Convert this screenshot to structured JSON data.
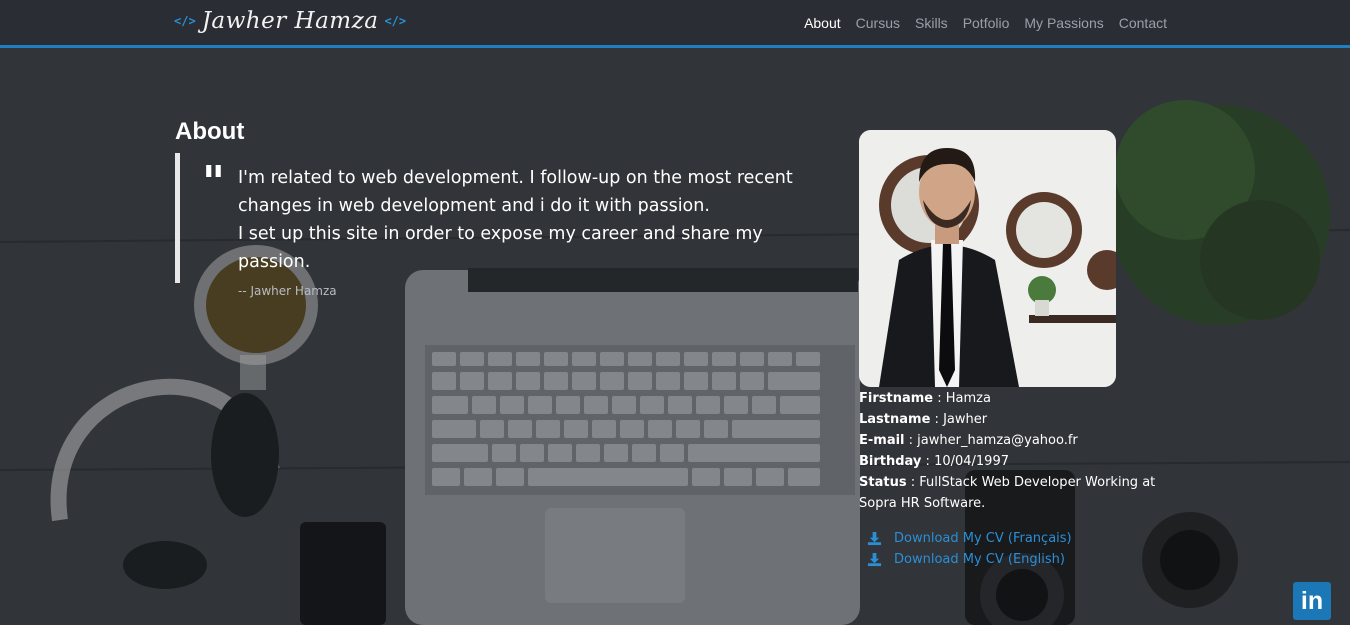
{
  "brand": {
    "code_left": "</>",
    "name": "Jawher Hamza",
    "code_right": "</>"
  },
  "nav": {
    "items": [
      {
        "label": "About",
        "active": true
      },
      {
        "label": "Cursus",
        "active": false
      },
      {
        "label": "Skills",
        "active": false
      },
      {
        "label": "Potfolio",
        "active": false
      },
      {
        "label": "My Passions",
        "active": false
      },
      {
        "label": "Contact",
        "active": false
      }
    ]
  },
  "about": {
    "title": "About",
    "quote_mark": "\"",
    "quote_lines": [
      "I'm related to web development. I follow-up on the most recent",
      "changes in web development and i do it with passion.",
      "I set up this site in order to expose my career and share my passion."
    ],
    "author": "--  Jawher Hamza"
  },
  "profile": {
    "fields": [
      {
        "label": "Firstname",
        "sep": " : ",
        "value": "Hamza"
      },
      {
        "label": "Lastname",
        "sep": " : ",
        "value": "Jawher"
      },
      {
        "label": "E-mail",
        "sep": " : ",
        "value": "jawher_hamza@yahoo.fr"
      },
      {
        "label": "Birthday",
        "sep": " : ",
        "value": "10/04/1997"
      },
      {
        "label": "Status",
        "sep": " : ",
        "value": "FullStack Web Developer Working at Sopra HR Software."
      }
    ],
    "downloads": [
      {
        "label": "Download My CV (Français)",
        "icon": "download-icon"
      },
      {
        "label": "Download My CV (English)",
        "icon": "download-icon"
      }
    ]
  },
  "social": {
    "linkedin_label": "in",
    "icon": "linkedin-icon"
  },
  "colors": {
    "accent": "#1e7fc1",
    "link": "#2b8fd6",
    "navbar": "#2a2d33"
  }
}
